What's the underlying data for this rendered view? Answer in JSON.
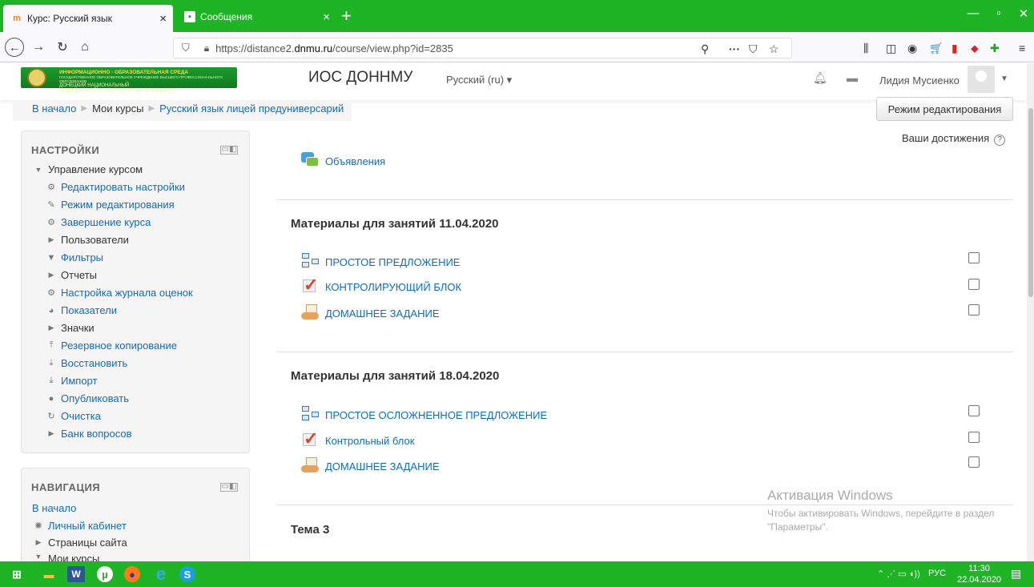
{
  "browser": {
    "tabs": [
      {
        "title": "Курс: Русский язык",
        "icon": "moodle-icon",
        "active": true
      },
      {
        "title": "Сообщения",
        "icon": "chat-icon",
        "active": false
      }
    ],
    "url_prefix": "https://distance2.",
    "url_domain": "dnmu.ru",
    "url_path": "/course/view.php?id=2835"
  },
  "header": {
    "logo_line1": "ИНФОРМАЦИОННО - ОБРАЗОВАТЕЛЬНАЯ СРЕДА",
    "logo_line2": "ГОСУДАРСТВЕННОЕ ОБРАЗОВАТЕЛЬНОЕ УЧРЕЖДЕНИЕ ВЫСШЕГО ПРОФЕССИОНАЛЬНОГО ОБРАЗОВАНИЯ",
    "logo_line3": "ДОНЕЦКИЙ НАЦИОНАЛЬНЫЙ",
    "logo_line4": "МЕДИЦИНСКИЙ УНИВЕРСИТЕТ ИМ. М.ГОРЬКОГО",
    "site_name": "ИОС ДОННМУ",
    "language": "Русский (ru) ▾",
    "user_name": "Лидия Мусиенко"
  },
  "breadcrumb": [
    "В начало",
    "Мои курсы",
    "Русский язык лицей предуниверсарий"
  ],
  "edit_button": "Режим редактирования",
  "settings_block": {
    "title": "НАСТРОЙКИ",
    "section": "Управление курсом",
    "items": [
      {
        "label": "Редактировать настройки",
        "icon": "gear-icon",
        "link": true
      },
      {
        "label": "Режим редактирования",
        "icon": "pencil-icon",
        "link": true
      },
      {
        "label": "Завершение курса",
        "icon": "gear-icon",
        "link": true
      },
      {
        "label": "Пользователи",
        "icon": "triangle-right-icon",
        "link": false
      },
      {
        "label": "Фильтры",
        "icon": "filter-icon",
        "link": true
      },
      {
        "label": "Отчеты",
        "icon": "triangle-right-icon",
        "link": false
      },
      {
        "label": "Настройка журнала оценок",
        "icon": "gear-icon",
        "link": true
      },
      {
        "label": "Показатели",
        "icon": "chart-pie-icon",
        "link": true
      },
      {
        "label": "Значки",
        "icon": "triangle-right-icon",
        "link": false
      },
      {
        "label": "Резервное копирование",
        "icon": "upload-icon",
        "link": true
      },
      {
        "label": "Восстановить",
        "icon": "download-icon",
        "link": true
      },
      {
        "label": "Импорт",
        "icon": "download-icon",
        "link": true
      },
      {
        "label": "Опубликовать",
        "icon": "globe-icon",
        "link": true
      },
      {
        "label": "Очистка",
        "icon": "refresh-icon",
        "link": true
      },
      {
        "label": "Банк вопросов",
        "icon": "triangle-right-icon",
        "link": true
      }
    ]
  },
  "navigation_block": {
    "title": "НАВИГАЦИЯ",
    "items": [
      {
        "label": "В начало",
        "icon": "",
        "link": true
      },
      {
        "label": "Личный кабинет",
        "icon": "dashboard-icon",
        "link": true
      },
      {
        "label": "Страницы сайта",
        "icon": "triangle-right-icon",
        "link": false
      },
      {
        "label": "Мои курсы",
        "icon": "triangle-down-icon",
        "link": false
      }
    ]
  },
  "achievements": "Ваши достижения",
  "forum": {
    "label": "Объявления",
    "icon": "forum-icon"
  },
  "sections": [
    {
      "title": "Материалы для занятий 11.04.2020",
      "activities": [
        {
          "label": "ПРОСТОЕ ПРЕДЛОЖЕНИЕ",
          "icon": "book-structure-icon"
        },
        {
          "label": "КОНТРОЛИРУЮЩИЙ БЛОК",
          "icon": "quiz-check-icon"
        },
        {
          "label": "ДОМАШНЕЕ ЗАДАНИЕ",
          "icon": "assignment-hand-icon"
        }
      ]
    },
    {
      "title": "Материалы для занятий 18.04.2020",
      "activities": [
        {
          "label": "ПРОСТОЕ ОСЛОЖНЕННОЕ ПРЕДЛОЖЕНИЕ",
          "icon": "book-structure-icon"
        },
        {
          "label": "Контрольный блок",
          "icon": "quiz-check-icon"
        },
        {
          "label": "ДОМАШНЕЕ ЗАДАНИЕ",
          "icon": "assignment-hand-icon"
        }
      ]
    },
    {
      "title": "Тема 3",
      "activities": []
    }
  ],
  "watermark": {
    "title": "Активация Windows",
    "text": "Чтобы активировать Windows, перейдите в раздел \"Параметры\"."
  },
  "taskbar": {
    "tray_lang": "РУС",
    "time": "11:30",
    "date": "22.04.2020"
  },
  "colors": {
    "accent": "#1fb425",
    "link": "#0f6cbf"
  }
}
